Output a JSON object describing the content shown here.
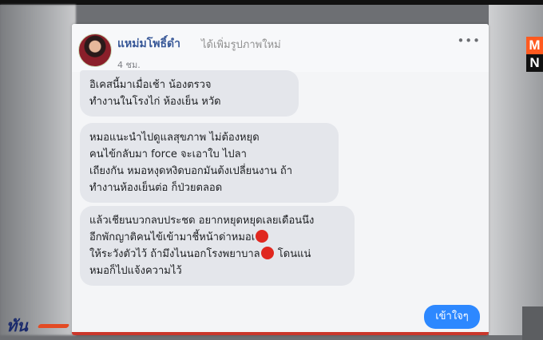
{
  "post": {
    "author_name": "แหม่มโพธิ์ดำ",
    "action_text": "ได้เพิ่มรูปภาพใหม่",
    "time": "4 ชม.",
    "more_icon": "more-horizontal-icon"
  },
  "chat": {
    "messages": [
      {
        "lines": [
          "อิเคสนี้มาเมื่อเช้า น้องตรวจ",
          "ทำงานในโรงไก่ ห้องเย็น หวัด"
        ]
      },
      {
        "lines": [
          "หมอแนะนำไปดูแลสุขภาพ ไม่ต้องหยุด",
          "คนไข้กลับมา force จะเอาใบ ไปลา",
          "เถียงกัน หมอหงุดหงิดบอกมันต้งเปลี่ยนงาน ถ้า",
          "ทำงานห้องเย็นต่อ ก็ป่วยตลอด"
        ]
      },
      {
        "lines": [
          "แล้วเชียนบวกลบประชด อยากหยุดหยุดเลยเดือนนึง",
          "อีกพักญาติคนไข้เข้ามาชี้หน้าด่าหมอเ",
          "ให้ระวังตัวไว้ ถ้ามึงไนนอกโรงพยาบาล",
          "หมอก็ไปแจ้งความไว้"
        ],
        "line3_suffix": " โดนแน่"
      }
    ],
    "reply": "เข้าใจๆ"
  },
  "colors": {
    "bubble": "#e4e6eb",
    "reply_bubble": "#2d88ff",
    "name": "#385898",
    "redaction": "#e0271f"
  },
  "overlay": {
    "logo_top": "M",
    "logo_bottom": "N",
    "brand": "ทัน"
  }
}
